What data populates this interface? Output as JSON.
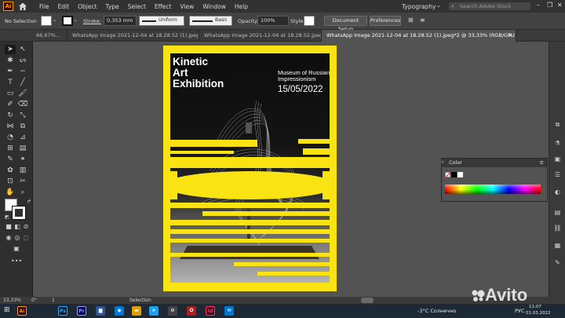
{
  "menubar": {
    "app_logo": "Ai",
    "items": [
      "File",
      "Edit",
      "Object",
      "Type",
      "Select",
      "Effect",
      "View",
      "Window",
      "Help"
    ],
    "workspace": "Typography",
    "search_placeholder": "Search Adobe Stock",
    "window_controls": [
      "–",
      "❐",
      "✕"
    ]
  },
  "control": {
    "selection_status": "No Selection",
    "stroke_label": "Stroke:",
    "stroke_weight": "0,353 mm",
    "profile": "Uniform",
    "brush": "Basic",
    "opacity_label": "Opacity:",
    "opacity_value": "100%",
    "style_label": "Style:",
    "doc_setup": "Document Setup",
    "preferences": "Preferences"
  },
  "tabs": [
    {
      "label": "66,67%...",
      "close": "×"
    },
    {
      "label": "WhatsApp Image 2021-12-04 at 18.28.52 (1).jpeg* @",
      "close": "×"
    },
    {
      "label": "WhatsApp Image 2021-12-04 at 18.28.52.jpeg*",
      "close": "×"
    },
    {
      "label": "WhatsApp Image 2021-12-04 at 18.28.52 (1).jpeg*2 @ 33,33% (RGB/GPU Preview)",
      "close": "×"
    }
  ],
  "poster": {
    "title_lines": [
      "Kinetic",
      "Art",
      "Exhibition"
    ],
    "museum_lines": [
      "Museum of Russian",
      "Impressionism"
    ],
    "date": "15/05/2022",
    "background_color": "#f9e313"
  },
  "color_panel": {
    "title": "Color",
    "menu_icon": "≡"
  },
  "status": {
    "zoom": "33,33%",
    "rotation": "0°",
    "artboard": "1",
    "tool": "Selection"
  },
  "taskbar": {
    "apps": [
      {
        "name": "Ai",
        "color": "#ff9a00",
        "bg": "#330000"
      },
      {
        "name": "Ps",
        "color": "#31a8ff",
        "bg": "#001e36"
      },
      {
        "name": "Pr",
        "color": "#9999ff",
        "bg": "#00005b"
      },
      {
        "name": "Id",
        "color": "#ff3366",
        "bg": "#49021f"
      }
    ],
    "weather": "-3°C  Солнечно",
    "lang": "РУС",
    "time": "11:07",
    "date": "01.03.2022"
  },
  "watermark": {
    "brand": "Avito"
  }
}
